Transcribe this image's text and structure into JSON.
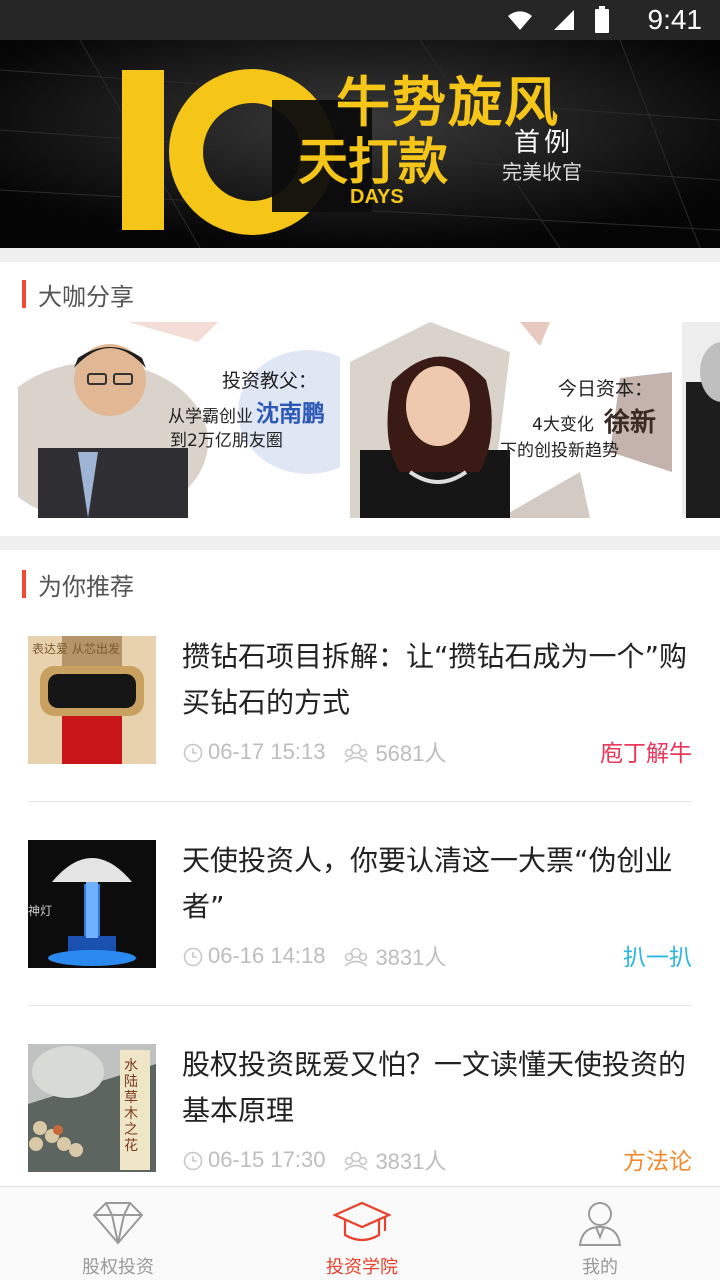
{
  "status_bar": {
    "time": "9:41"
  },
  "banner": {
    "big_number": "10",
    "days": "DAYS",
    "headline_1": "牛势旋风",
    "headline_2": "天打款",
    "sub_1": "首例",
    "sub_2": "完美收官",
    "accent": "#f5c518"
  },
  "experts": {
    "section_title": "大咖分享",
    "cards": [
      {
        "heading": "投资教父：",
        "line1": "从学霸创业",
        "name": "沈南鹏",
        "line2": "到2万亿朋友圈"
      },
      {
        "heading": "今日资本：",
        "line1": "4大变化",
        "name": "徐新",
        "line2": "下的创投新趋势"
      }
    ]
  },
  "recommend": {
    "section_title": "为你推荐",
    "items": [
      {
        "title": "攒钻石项目拆解：让“攒钻石成为一个”购买钻石的方式",
        "time": "06-17 15:13",
        "views": "5681人",
        "tag": "庖丁解牛",
        "tag_color": "#e8375a",
        "thumb_text": "表达爱 从芯出发"
      },
      {
        "title": "天使投资人，你要认清这一大票“伪创业者”",
        "time": "06-16 14:18",
        "views": "3831人",
        "tag": "扒一扒",
        "tag_color": "#2bb8e0",
        "thumb_text": "神灯"
      },
      {
        "title": "股权投资既爱又怕？一文读懂天使投资的基本原理",
        "time": "06-15 17:30",
        "views": "3831人",
        "tag": "方法论",
        "tag_color": "#f08a2c",
        "thumb_text": "水陆草木之花"
      }
    ]
  },
  "bottom_nav": {
    "items": [
      {
        "label": "股权投资",
        "icon": "diamond-icon",
        "active": false
      },
      {
        "label": "投资学院",
        "icon": "graduation-cap-icon",
        "active": true
      },
      {
        "label": "我的",
        "icon": "user-icon",
        "active": false
      }
    ],
    "active_color": "#e8412c",
    "inactive_color": "#999999"
  }
}
